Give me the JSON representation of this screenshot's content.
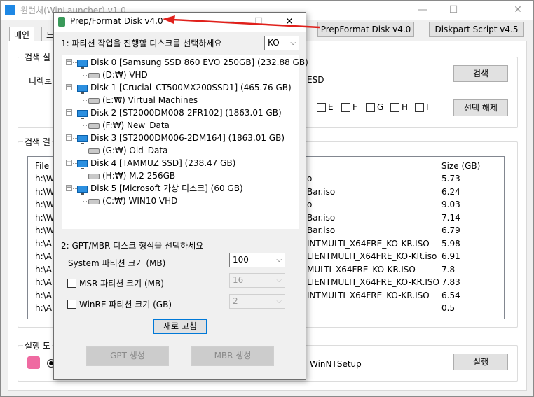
{
  "app": {
    "title": "윈런처(WinLauncher) v1.0",
    "caption": {
      "minimize": "—",
      "maximize": "☐",
      "close": "✕"
    },
    "tabs": [
      "메인",
      "도"
    ],
    "buttons": {
      "prepformat": "PrepFormat Disk v4.0",
      "diskpart": "Diskpart Script v4.5",
      "search": "검색",
      "deselect": "선택 해제",
      "run": "실행"
    },
    "groups": {
      "search_settings": "검색 설",
      "search_results": "검색 결",
      "run_options": "실행 도"
    },
    "directory_label": "디렉토",
    "esd_label": "ESD",
    "drive_checks": [
      "E",
      "F",
      "G",
      "H",
      "I"
    ],
    "winntsetup_label": "WinNTSetup",
    "file_list": {
      "header_path": "File P",
      "header_size": "Size (GB)",
      "rows": [
        {
          "prefix": "h:\\W",
          "name": "o",
          "size": "5.73"
        },
        {
          "prefix": "h:\\W",
          "name": "Bar.iso",
          "size": "6.24"
        },
        {
          "prefix": "h:\\W",
          "name": "o",
          "size": "9.03"
        },
        {
          "prefix": "h:\\W",
          "name": "Bar.iso",
          "size": "7.14"
        },
        {
          "prefix": "h:\\W",
          "name": "Bar.iso",
          "size": "6.79"
        },
        {
          "prefix": "h:\\A",
          "name": "INTMULTI_X64FRE_KO-KR.ISO",
          "size": "5.98"
        },
        {
          "prefix": "h:\\A",
          "name": "LIENTMULTI_X64FRE_KO-KR.iso",
          "size": "6.91"
        },
        {
          "prefix": "h:\\A",
          "name": "MULTI_X64FRE_KO-KR.ISO",
          "size": "7.8"
        },
        {
          "prefix": "h:\\A",
          "name": "LIENTMULTI_X64FRE_KO-KR.ISO",
          "size": "7.83"
        },
        {
          "prefix": "h:\\A",
          "name": "INTMULTI_X64FRE_KO-KR.ISO",
          "size": "6.54"
        },
        {
          "prefix": "h:\\A",
          "name": "",
          "size": "0.5"
        }
      ]
    }
  },
  "dialog": {
    "title": "Prep/Format Disk v4.0",
    "caption": {
      "minimize": "—",
      "maximize": "☐",
      "close": "✕"
    },
    "step1_label": "1: 파티션 작업을 진행할 디스크를 선택하세요",
    "language": "KO",
    "disks": [
      {
        "label": "Disk 0 [Samsung SSD 860 EVO 250GB] (232.88 GB)",
        "volume": "(D:₩) VHD"
      },
      {
        "label": "Disk 1 [Crucial_CT500MX200SSD1] (465.76 GB)",
        "volume": "(E:₩) Virtual Machines"
      },
      {
        "label": "Disk 2 [ST2000DM008-2FR102] (1863.01 GB)",
        "volume": "(F:₩) New_Data"
      },
      {
        "label": "Disk 3 [ST2000DM006-2DM164] (1863.01 GB)",
        "volume": "(G:₩) Old_Data"
      },
      {
        "label": "Disk 4 [TAMMUZ SSD] (238.47 GB)",
        "volume": "(H:₩) M.2 256GB"
      },
      {
        "label": "Disk 5 [Microsoft 가상 디스크] (60 GB)",
        "volume": "(C:₩) WIN10 VHD"
      }
    ],
    "step2_label": "2: GPT/MBR 디스크 형식을 선택하세요",
    "system_partition_label": "System 파티션 크기 (MB)",
    "system_partition_value": "100",
    "msr_label": "MSR 파티션 크기 (MB)",
    "msr_value": "16",
    "winre_label": "WinRE 파티션 크기 (GB)",
    "winre_value": "2",
    "refresh": "새로 고침",
    "gpt_create": "GPT 생성",
    "mbr_create": "MBR 생성"
  },
  "colors": {
    "arrow": "#e0201b",
    "disk_icon": "#2b8fe0"
  }
}
